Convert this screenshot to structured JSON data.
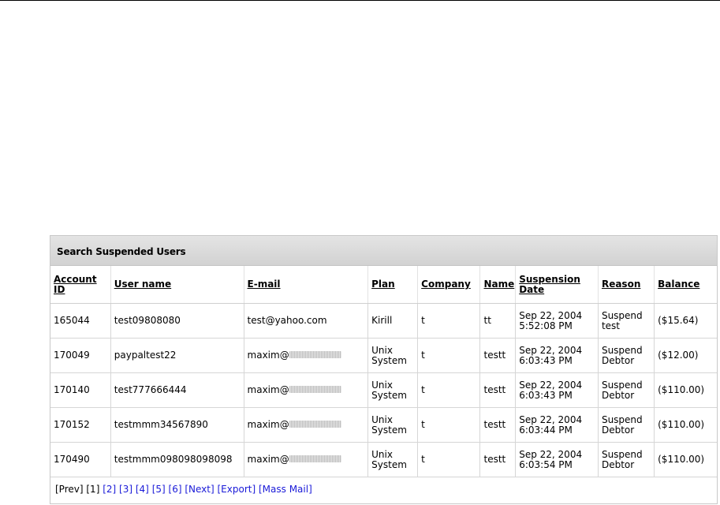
{
  "panel": {
    "title": "Search Suspended Users"
  },
  "columns": [
    "Account ID",
    "User name",
    "E-mail",
    "Plan",
    "Company",
    "Name",
    "Suspension Date",
    "Reason",
    "Balance"
  ],
  "rows": [
    {
      "account_id": "165044",
      "user_name": "test09808080",
      "email": "test@yahoo.com",
      "email_blurred": false,
      "plan": "Kirill",
      "company": "t",
      "name": "tt",
      "date": "Sep 22, 2004",
      "time": "5:52:08 PM",
      "reason_1": "Suspend",
      "reason_2": "test",
      "balance": "($15.64)"
    },
    {
      "account_id": "170049",
      "user_name": "paypaltest22",
      "email": "maxim@",
      "email_blurred": true,
      "plan_1": "Unix",
      "plan_2": "System",
      "company": "t",
      "name": "testt",
      "date": "Sep 22, 2004",
      "time": "6:03:43 PM",
      "reason_1": "Suspend",
      "reason_2": "Debtor",
      "balance": "($12.00)"
    },
    {
      "account_id": "170140",
      "user_name": "test777666444",
      "email": "maxim@",
      "email_blurred": true,
      "plan_1": "Unix",
      "plan_2": "System",
      "company": "t",
      "name": "testt",
      "date": "Sep 22, 2004",
      "time": "6:03:43 PM",
      "reason_1": "Suspend",
      "reason_2": "Debtor",
      "balance": "($110.00)"
    },
    {
      "account_id": "170152",
      "user_name": "testmmm34567890",
      "email": "maxim@",
      "email_blurred": true,
      "plan_1": "Unix",
      "plan_2": "System",
      "company": "t",
      "name": "testt",
      "date": "Sep 22, 2004",
      "time": "6:03:44 PM",
      "reason_1": "Suspend",
      "reason_2": "Debtor",
      "balance": "($110.00)"
    },
    {
      "account_id": "170490",
      "user_name": "testmmm098098098098",
      "email": "maxim@",
      "email_blurred": true,
      "plan_1": "Unix",
      "plan_2": "System",
      "company": "t",
      "name": "testt",
      "date": "Sep 22, 2004",
      "time": "6:03:54 PM",
      "reason_1": "Suspend",
      "reason_2": "Debtor",
      "balance": "($110.00)"
    }
  ],
  "pager": {
    "prev": "[Prev]",
    "current": "[1]",
    "pages": [
      "[2]",
      "[3]",
      "[4]",
      "[5]",
      "[6]"
    ],
    "next": "[Next]",
    "export": "[Export]",
    "mass_mail": "[Mass Mail]"
  },
  "colors": {
    "link": "#1a1ad8",
    "header_bg": "#d8d8d8"
  }
}
